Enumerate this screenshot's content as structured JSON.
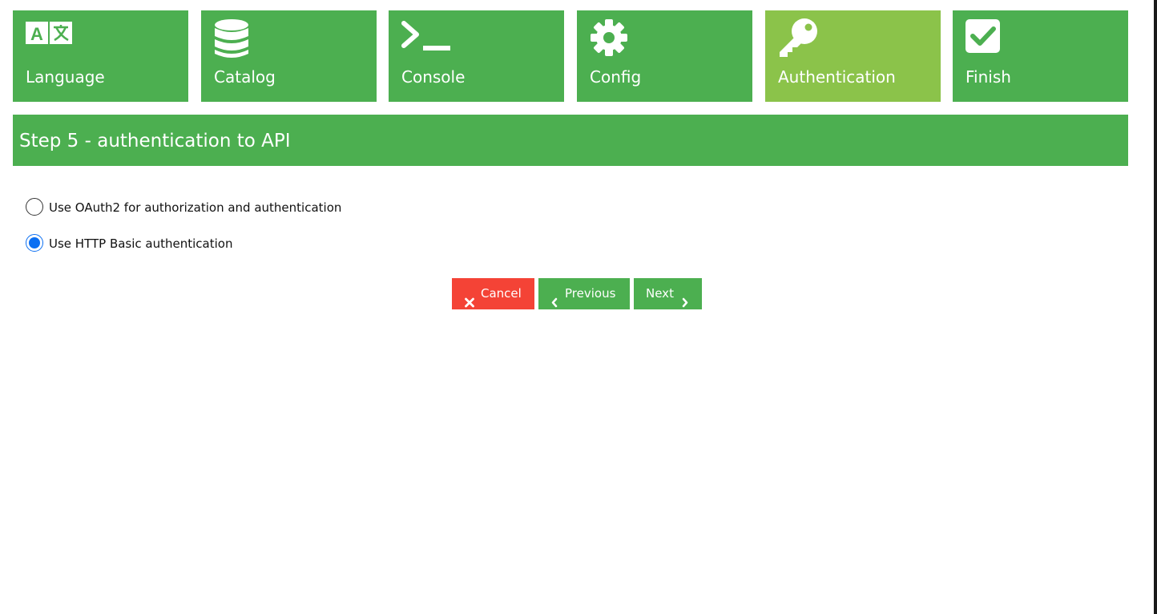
{
  "wizard": {
    "steps": [
      {
        "label": "Language",
        "icon": "language-icon",
        "active": false
      },
      {
        "label": "Catalog",
        "icon": "database-icon",
        "active": false
      },
      {
        "label": "Console",
        "icon": "terminal-icon",
        "active": false
      },
      {
        "label": "Config",
        "icon": "gear-icon",
        "active": false
      },
      {
        "label": "Authentication",
        "icon": "key-icon",
        "active": true
      },
      {
        "label": "Finish",
        "icon": "check-square-icon",
        "active": false
      }
    ],
    "current_step_title": "Step 5 - authentication to API"
  },
  "auth_options": [
    {
      "label": "Use OAuth2 for authorization and authentication",
      "checked": false
    },
    {
      "label": "Use HTTP Basic authentication",
      "checked": true
    }
  ],
  "buttons": {
    "cancel_label": "Cancel",
    "previous_label": "Previous",
    "next_label": "Next"
  },
  "colors": {
    "step_green": "#4caf50",
    "step_active": "#8bc34a",
    "cancel_red": "#f44336",
    "radio_selected": "#0b6ff2"
  }
}
